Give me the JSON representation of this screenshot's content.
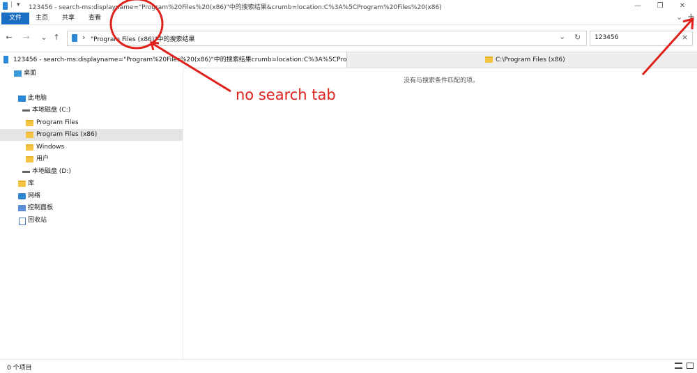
{
  "titlebar": {
    "title": "123456 - search-ms:displayname=\"Program%20Files%20(x86)\"中的搜索结果&crumb=location:C%3A%5CProgram%20Files%20(x86)",
    "quick_access_sep": "|",
    "quick_access_arrow": "▾",
    "minimize": "—",
    "maximize": "❐",
    "close": "✕"
  },
  "ribbon": {
    "tabs": [
      "文件",
      "主页",
      "共享",
      "查看"
    ],
    "collapse_chevron": "⌄",
    "new_tab_plus": "+"
  },
  "nav": {
    "back": "←",
    "forward": "→",
    "recent": "⌄",
    "up": "↑"
  },
  "address": {
    "sep": "›",
    "path": "\"Program Files (x86)\"中的搜索结果",
    "dropdown": "⌄",
    "refresh": "↻"
  },
  "search": {
    "value": "123456",
    "clear": "×"
  },
  "tabs": [
    {
      "label": "123456 - search-ms:displayname=\"Program%20Files%20(x86)\"中的搜索结果crumb=location:C%3A%5CProgra..."
    },
    {
      "label": "C:\\Program Files (x86)"
    }
  ],
  "sidebar": {
    "items": [
      {
        "label": "桌面",
        "icon": "desktop-icon"
      },
      {
        "label": "此电脑",
        "icon": "computer-icon"
      },
      {
        "label": "本地磁盘 (C:)",
        "icon": "drive-icon"
      },
      {
        "label": "Program Files",
        "icon": "folder-icon"
      },
      {
        "label": "Program Files (x86)",
        "icon": "folder-icon"
      },
      {
        "label": "Windows",
        "icon": "folder-icon"
      },
      {
        "label": "用户",
        "icon": "folder-icon"
      },
      {
        "label": "本地磁盘 (D:)",
        "icon": "drive-icon"
      },
      {
        "label": "库",
        "icon": "library-icon"
      },
      {
        "label": "网络",
        "icon": "network-icon"
      },
      {
        "label": "控制面板",
        "icon": "control-panel-icon"
      },
      {
        "label": "回收站",
        "icon": "recycle-bin-icon"
      }
    ]
  },
  "content": {
    "empty_message": "没有与搜索条件匹配的项。"
  },
  "status": {
    "count": "0 个项目"
  },
  "annotation": {
    "label": "no search tab",
    "color": "#e0201a"
  },
  "colors": {
    "accent": "#1a6dc5",
    "selection": "#e5e5e5",
    "folder": "#f4c542"
  }
}
